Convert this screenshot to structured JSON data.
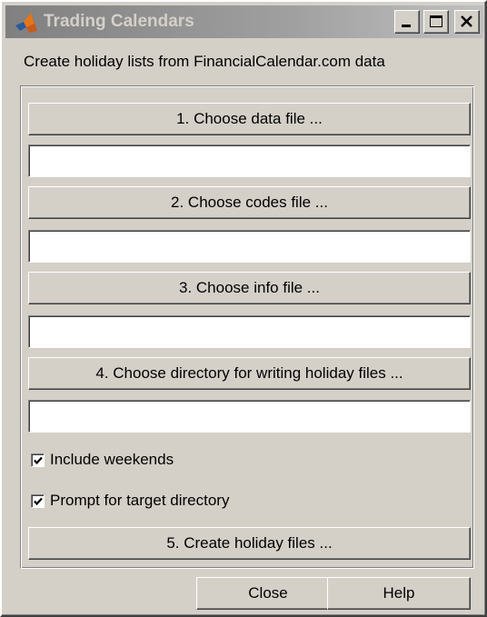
{
  "window": {
    "title": "Trading Calendars",
    "controls": {
      "minimize_icon": "minimize-icon",
      "maximize_icon": "maximize-icon",
      "close_icon": "close-icon"
    },
    "app_icon": "matlab-logo-icon"
  },
  "instruction": "Create holiday lists from FinancialCalendar.com data",
  "steps": [
    {
      "button_label": "1. Choose data file ...",
      "field_value": ""
    },
    {
      "button_label": "2. Choose codes file ...",
      "field_value": ""
    },
    {
      "button_label": "3. Choose info file ...",
      "field_value": ""
    },
    {
      "button_label": "4. Choose directory for writing holiday files ...",
      "field_value": ""
    }
  ],
  "options": {
    "include_weekends": {
      "label": "Include weekends",
      "checked": true
    },
    "prompt_target_directory": {
      "label": "Prompt for target directory",
      "checked": true
    }
  },
  "create_button_label": "5. Create holiday files ...",
  "footer": {
    "close_label": "Close",
    "help_label": "Help"
  },
  "colors": {
    "face": "#d4d0c8",
    "title_gradient_start": "#808080",
    "title_text": "#d4d0c8"
  }
}
